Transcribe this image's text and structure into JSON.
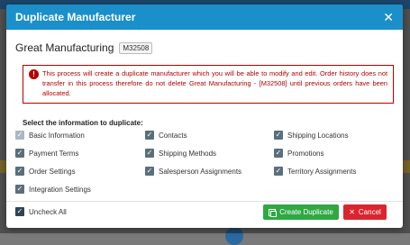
{
  "dialog": {
    "title": "Duplicate Manufacturer",
    "close_icon": "close-icon"
  },
  "manufacturer": {
    "name": "Great Manufacturing",
    "code": "M32508"
  },
  "alert": {
    "icon": "!",
    "text": "This process will create a duplicate manufacturer which you will be able to modify and edit. Order history does not transfer in this process therefore do not delete Great Manufacturing - [M32508] until previous orders have been allocated."
  },
  "section_label": "Select the information to duplicate:",
  "options": {
    "basic_information": {
      "label": "Basic Information",
      "checked": true,
      "disabled": true
    },
    "contacts": {
      "label": "Contacts",
      "checked": true
    },
    "shipping_locations": {
      "label": "Shipping Locations",
      "checked": true
    },
    "payment_terms": {
      "label": "Payment Terms",
      "checked": true
    },
    "shipping_methods": {
      "label": "Shipping Methods",
      "checked": true
    },
    "promotions": {
      "label": "Promotions",
      "checked": true
    },
    "order_settings": {
      "label": "Order Settings",
      "checked": true
    },
    "salesperson_assignments": {
      "label": "Salesperson Assignments",
      "checked": true
    },
    "territory_assignments": {
      "label": "Territory Assignments",
      "checked": true
    },
    "integration_settings": {
      "label": "Integration Settings",
      "checked": true
    }
  },
  "uncheck_all": {
    "label": "Uncheck All",
    "checked": true
  },
  "buttons": {
    "create": "Create Duplicate",
    "cancel": "Cancel"
  },
  "colors": {
    "header": "#1a8fc9",
    "alert": "#b30000",
    "create_button": "#2fa843",
    "cancel_button": "#d9262e"
  }
}
